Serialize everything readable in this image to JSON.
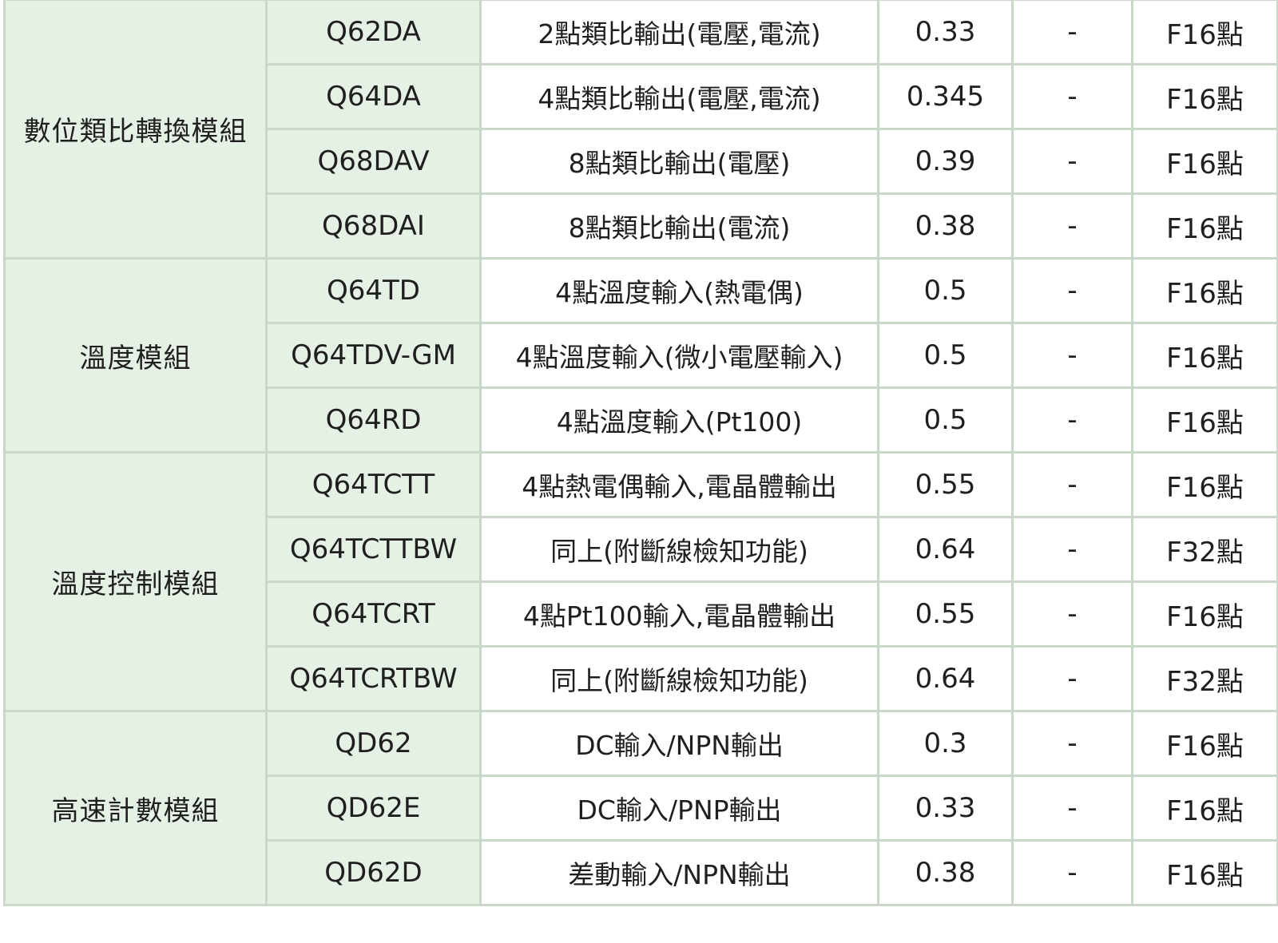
{
  "groups": [
    {
      "name": "數位類比轉換模組",
      "rows": [
        {
          "model": "Q62DA",
          "desc": "2點類比輸出(電壓,電流)",
          "current": "0.33",
          "dash": "-",
          "points": "F16點"
        },
        {
          "model": "Q64DA",
          "desc": "4點類比輸出(電壓,電流)",
          "current": "0.345",
          "dash": "-",
          "points": "F16點"
        },
        {
          "model": "Q68DAV",
          "desc": "8點類比輸出(電壓)",
          "current": "0.39",
          "dash": "-",
          "points": "F16點"
        },
        {
          "model": "Q68DAI",
          "desc": "8點類比輸出(電流)",
          "current": "0.38",
          "dash": "-",
          "points": "F16點"
        }
      ]
    },
    {
      "name": "溫度模組",
      "rows": [
        {
          "model": "Q64TD",
          "desc": "4點溫度輸入(熱電偶)",
          "current": "0.5",
          "dash": "-",
          "points": "F16點"
        },
        {
          "model": "Q64TDV-GM",
          "desc": "4點溫度輸入(微小電壓輸入)",
          "current": "0.5",
          "dash": "-",
          "points": "F16點"
        },
        {
          "model": "Q64RD",
          "desc": "4點溫度輸入(Pt100)",
          "current": "0.5",
          "dash": "-",
          "points": "F16點"
        }
      ]
    },
    {
      "name": "溫度控制模組",
      "rows": [
        {
          "model": "Q64TCTT",
          "desc": "4點熱電偶輸入,電晶體輸出",
          "current": "0.55",
          "dash": "-",
          "points": "F16點"
        },
        {
          "model": "Q64TCTTBW",
          "desc": "同上(附斷線檢知功能)",
          "current": "0.64",
          "dash": "-",
          "points": "F32點"
        },
        {
          "model": "Q64TCRT",
          "desc": "4點Pt100輸入,電晶體輸出",
          "current": "0.55",
          "dash": "-",
          "points": "F16點"
        },
        {
          "model": "Q64TCRTBW",
          "desc": "同上(附斷線檢知功能)",
          "current": "0.64",
          "dash": "-",
          "points": "F32點"
        }
      ]
    },
    {
      "name": "高速計數模組",
      "rows": [
        {
          "model": "QD62",
          "desc": "DC輸入/NPN輸出",
          "current": "0.3",
          "dash": "-",
          "points": "F16點"
        },
        {
          "model": "QD62E",
          "desc": "DC輸入/PNP輸出",
          "current": "0.33",
          "dash": "-",
          "points": "F16點"
        },
        {
          "model": "QD62D",
          "desc": "差動輸入/NPN輸出",
          "current": "0.38",
          "dash": "-",
          "points": "F16點"
        }
      ]
    }
  ],
  "colors": {
    "label_bg": "#e4f1e4",
    "grid": "#c9d8c9",
    "text": "#1f1f1f"
  }
}
